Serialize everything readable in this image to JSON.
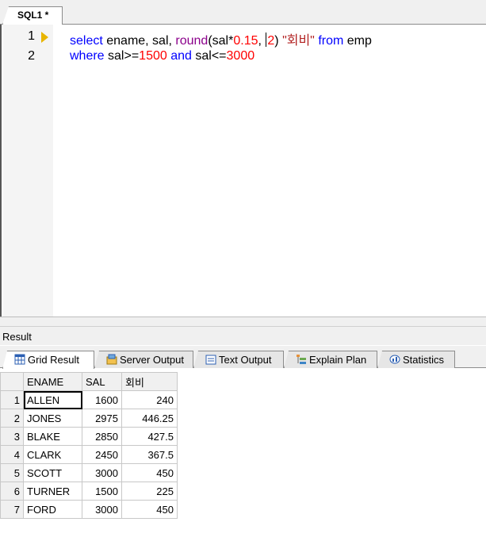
{
  "editor": {
    "tab_label": "SQL1 *",
    "lines": [
      {
        "number": "1",
        "kw1": "select",
        "t1": " ename, sal, ",
        "fn": "round",
        "t2": "(sal*",
        "n1": "0.15",
        "t3": ", ",
        "n2": "2",
        "t4": ") ",
        "alias": "\"회비\"",
        "t5": " ",
        "kw2": "from",
        "t6": " emp"
      },
      {
        "number": "2",
        "kw1": "where",
        "t1": " sal>=",
        "n1": "1500",
        "t2": " ",
        "kw2": "and",
        "t3": " sal<=",
        "n2": "3000"
      }
    ]
  },
  "result": {
    "title": "Result",
    "tabs": [
      {
        "label": "Grid Result",
        "icon": "grid-icon"
      },
      {
        "label": "Server Output",
        "icon": "server-output-icon"
      },
      {
        "label": "Text Output",
        "icon": "text-output-icon"
      },
      {
        "label": "Explain Plan",
        "icon": "explain-plan-icon"
      },
      {
        "label": "Statistics",
        "icon": "statistics-icon"
      }
    ],
    "columns": [
      "ENAME",
      "SAL",
      "회비"
    ],
    "rows": [
      {
        "n": "1",
        "ename": "ALLEN",
        "sal": "1600",
        "fee": "240"
      },
      {
        "n": "2",
        "ename": "JONES",
        "sal": "2975",
        "fee": "446.25"
      },
      {
        "n": "3",
        "ename": "BLAKE",
        "sal": "2850",
        "fee": "427.5"
      },
      {
        "n": "4",
        "ename": "CLARK",
        "sal": "2450",
        "fee": "367.5"
      },
      {
        "n": "5",
        "ename": "SCOTT",
        "sal": "3000",
        "fee": "450"
      },
      {
        "n": "6",
        "ename": "TURNER",
        "sal": "1500",
        "fee": "225"
      },
      {
        "n": "7",
        "ename": "FORD",
        "sal": "3000",
        "fee": "450"
      }
    ]
  },
  "colors": {
    "keyword": "#0000ff",
    "function": "#8b008b",
    "number": "#ff0000",
    "exec_marker": "#e8b500"
  }
}
